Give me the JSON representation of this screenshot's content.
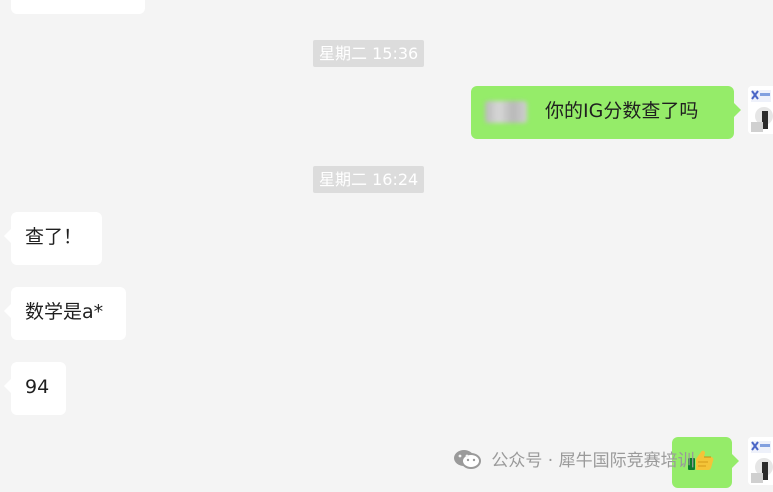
{
  "chat": {
    "timestamps": [
      "星期二 15:36",
      "星期二 16:24"
    ],
    "messages": [
      {
        "side": "right",
        "text": "你的IG分数查了吗"
      },
      {
        "side": "left",
        "text": "查了！"
      },
      {
        "side": "left",
        "text": "数学是a*"
      },
      {
        "side": "left",
        "text": "94"
      },
      {
        "side": "right",
        "text": ""
      }
    ]
  },
  "icons": {
    "wechat": "wechat-icon",
    "thumb": "thumbs-up-emoji-icon",
    "avatar": "avatar-image"
  },
  "watermark": {
    "text": "公众号 · 犀牛国际竞赛培训"
  },
  "colors": {
    "background": "#f4f4f4",
    "incoming": "#ffffff",
    "outgoing": "#95ec69",
    "timestamp": "#dcdcdc"
  }
}
